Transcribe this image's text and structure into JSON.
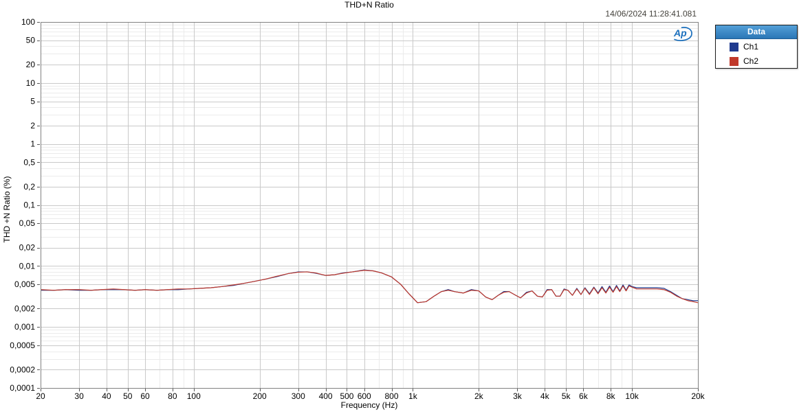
{
  "header": {
    "title": "THD+N Ratio",
    "timestamp": "14/06/2024 11:28:41.081"
  },
  "legend": {
    "title": "Data",
    "position": "top-right"
  },
  "logo": {
    "name": "ap-logo",
    "text": "Ap",
    "color": "#1a6fbd"
  },
  "colors": {
    "plot_border": "#808080",
    "grid_major": "#c9c9c9",
    "grid_minor": "#ebebeb",
    "tick": "#555555",
    "ch1": "#1F3A8F",
    "ch2": "#C0392B"
  },
  "chart_data": {
    "type": "line",
    "title": "THD+N Ratio",
    "xlabel": "Frequency (Hz)",
    "ylabel": "THD +N Ratio (%)",
    "xscale": "log",
    "yscale": "log",
    "xlim": [
      20,
      20000
    ],
    "ylim": [
      0.0001,
      100
    ],
    "grid": true,
    "legend_position": "top-right",
    "x_ticks": [
      {
        "v": 20,
        "label": "20"
      },
      {
        "v": 30,
        "label": "30"
      },
      {
        "v": 40,
        "label": "40"
      },
      {
        "v": 50,
        "label": "50"
      },
      {
        "v": 60,
        "label": "60"
      },
      {
        "v": 80,
        "label": "80"
      },
      {
        "v": 100,
        "label": "100"
      },
      {
        "v": 200,
        "label": "200"
      },
      {
        "v": 300,
        "label": "300"
      },
      {
        "v": 400,
        "label": "400"
      },
      {
        "v": 500,
        "label": "500"
      },
      {
        "v": 600,
        "label": "600"
      },
      {
        "v": 800,
        "label": "800"
      },
      {
        "v": 1000,
        "label": "1k"
      },
      {
        "v": 2000,
        "label": "2k"
      },
      {
        "v": 3000,
        "label": "3k"
      },
      {
        "v": 4000,
        "label": "4k"
      },
      {
        "v": 5000,
        "label": "5k"
      },
      {
        "v": 6000,
        "label": "6k"
      },
      {
        "v": 8000,
        "label": "8k"
      },
      {
        "v": 10000,
        "label": "10k"
      },
      {
        "v": 20000,
        "label": "20k"
      }
    ],
    "y_ticks": [
      {
        "v": 100,
        "label": "100"
      },
      {
        "v": 50,
        "label": "50"
      },
      {
        "v": 20,
        "label": "20"
      },
      {
        "v": 10,
        "label": "10"
      },
      {
        "v": 5,
        "label": "5"
      },
      {
        "v": 2,
        "label": "2"
      },
      {
        "v": 1,
        "label": "1"
      },
      {
        "v": 0.5,
        "label": "0,5"
      },
      {
        "v": 0.2,
        "label": "0,2"
      },
      {
        "v": 0.1,
        "label": "0,1"
      },
      {
        "v": 0.05,
        "label": "0,05"
      },
      {
        "v": 0.02,
        "label": "0,02"
      },
      {
        "v": 0.01,
        "label": "0,01"
      },
      {
        "v": 0.005,
        "label": "0,005"
      },
      {
        "v": 0.002,
        "label": "0,002"
      },
      {
        "v": 0.001,
        "label": "0,001"
      },
      {
        "v": 0.0005,
        "label": "0,0005"
      },
      {
        "v": 0.0002,
        "label": "0,0002"
      },
      {
        "v": 0.0001,
        "label": "0,0001"
      }
    ],
    "x": [
      20,
      23,
      26,
      30,
      34,
      38,
      43,
      48,
      54,
      60,
      68,
      76,
      85,
      95,
      107,
      120,
      135,
      152,
      170,
      190,
      213,
      240,
      270,
      300,
      330,
      360,
      400,
      440,
      480,
      530,
      600,
      660,
      720,
      800,
      880,
      960,
      1050,
      1150,
      1250,
      1350,
      1450,
      1550,
      1700,
      1850,
      2000,
      2150,
      2300,
      2450,
      2600,
      2750,
      2950,
      3100,
      3300,
      3500,
      3700,
      3900,
      4100,
      4300,
      4500,
      4700,
      4900,
      5100,
      5350,
      5600,
      5850,
      6100,
      6400,
      6700,
      7000,
      7300,
      7600,
      7900,
      8200,
      8500,
      8800,
      9100,
      9400,
      9700,
      10000,
      10500,
      11000,
      12000,
      13000,
      14000,
      15000,
      16000,
      17000,
      18000,
      19000,
      20000
    ],
    "series": [
      {
        "name": "Ch1",
        "color": "#1F3A8F",
        "values": [
          0.004,
          0.004,
          0.0041,
          0.004,
          0.004,
          0.0041,
          0.0041,
          0.0041,
          0.004,
          0.0041,
          0.004,
          0.0041,
          0.0041,
          0.0042,
          0.0043,
          0.0044,
          0.0046,
          0.0048,
          0.0052,
          0.0056,
          0.0061,
          0.0067,
          0.0075,
          0.008,
          0.008,
          0.0076,
          0.007,
          0.0072,
          0.0077,
          0.008,
          0.0086,
          0.0083,
          0.0077,
          0.0066,
          0.005,
          0.0035,
          0.0025,
          0.0026,
          0.0032,
          0.0038,
          0.0041,
          0.0038,
          0.0036,
          0.0041,
          0.0039,
          0.0031,
          0.0028,
          0.0033,
          0.0038,
          0.0038,
          0.0033,
          0.003,
          0.0037,
          0.0039,
          0.0032,
          0.0031,
          0.0041,
          0.0041,
          0.0032,
          0.0032,
          0.0042,
          0.004,
          0.0033,
          0.0043,
          0.0034,
          0.0044,
          0.0035,
          0.0045,
          0.0036,
          0.0046,
          0.0037,
          0.0047,
          0.0038,
          0.0048,
          0.0039,
          0.0049,
          0.004,
          0.0049,
          0.0046,
          0.0044,
          0.0044,
          0.0044,
          0.0044,
          0.0043,
          0.0038,
          0.0033,
          0.0029,
          0.0028,
          0.0027,
          0.0027
        ]
      },
      {
        "name": "Ch2",
        "color": "#C0392B",
        "values": [
          0.0041,
          0.004,
          0.0041,
          0.0041,
          0.004,
          0.0041,
          0.0042,
          0.0041,
          0.004,
          0.0041,
          0.004,
          0.0041,
          0.0042,
          0.0042,
          0.0043,
          0.0044,
          0.0046,
          0.0049,
          0.0052,
          0.0056,
          0.0061,
          0.0068,
          0.0075,
          0.0079,
          0.008,
          0.0077,
          0.007,
          0.0072,
          0.0076,
          0.008,
          0.0085,
          0.0083,
          0.0077,
          0.0066,
          0.005,
          0.0035,
          0.0025,
          0.0026,
          0.0032,
          0.0038,
          0.004,
          0.0038,
          0.0036,
          0.004,
          0.0039,
          0.0031,
          0.0028,
          0.0033,
          0.0037,
          0.0038,
          0.0033,
          0.003,
          0.0036,
          0.0039,
          0.0032,
          0.0031,
          0.004,
          0.0041,
          0.0032,
          0.0032,
          0.0041,
          0.004,
          0.0033,
          0.0042,
          0.0034,
          0.0043,
          0.0034,
          0.0044,
          0.0035,
          0.0044,
          0.0036,
          0.0045,
          0.0037,
          0.0046,
          0.0038,
          0.0047,
          0.0039,
          0.0047,
          0.0045,
          0.0042,
          0.0042,
          0.0042,
          0.0042,
          0.0041,
          0.0037,
          0.0032,
          0.0029,
          0.0027,
          0.0026,
          0.0025
        ]
      }
    ]
  }
}
